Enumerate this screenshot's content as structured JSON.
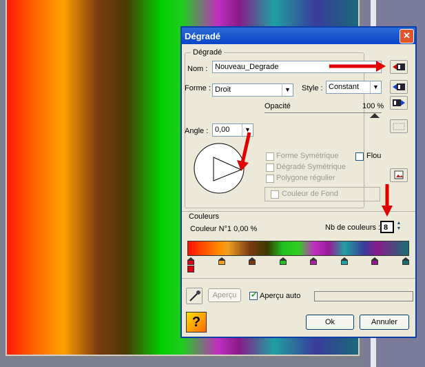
{
  "dialog": {
    "title": "Dégradé",
    "close_glyph": "✕",
    "gradient_group": {
      "legend": "Dégradé",
      "name_label": "Nom :",
      "name_value": "Nouveau_Degrade",
      "forme_label": "Forme :",
      "forme_value": "Droit",
      "style_label": "Style :",
      "style_value": "Constant",
      "opacity_label": "Opacité",
      "opacity_value": "100 %",
      "angle_label": "Angle :",
      "angle_value": "0,00",
      "forme_symetrique": "Forme Symétrique",
      "degrade_symetrique": "Dégradé Symétrique",
      "polygone_regulier": "Polygone régulier",
      "flou": "Flou",
      "couleur_de_fond": "Couleur de Fond"
    },
    "colors_group": {
      "legend": "Couleurs",
      "couleur_info": "Couleur N°1 0,00 %",
      "nb_label": "Nb de couleurs :",
      "nb_value": "8",
      "stops": [
        {
          "color": "#e00010",
          "pos": 0.0
        },
        {
          "color": "#f0a020",
          "pos": 0.143
        },
        {
          "color": "#7a3a10",
          "pos": 0.286
        },
        {
          "color": "#20c020",
          "pos": 0.429
        },
        {
          "color": "#b020a0",
          "pos": 0.571
        },
        {
          "color": "#20a0a0",
          "pos": 0.714
        },
        {
          "color": "#8a1a8a",
          "pos": 0.857
        },
        {
          "color": "#1a7070",
          "pos": 1.0
        }
      ]
    },
    "bottom": {
      "apercu_label": "Aperçu",
      "apercu_auto_label": "Aperçu auto",
      "ok_label": "Ok",
      "annuler_label": "Annuler",
      "help_glyph": "?"
    }
  },
  "colors": {
    "title_bar": "#0a46c8",
    "dialog_bg": "#ece9d8",
    "arrow": "#e00000"
  }
}
